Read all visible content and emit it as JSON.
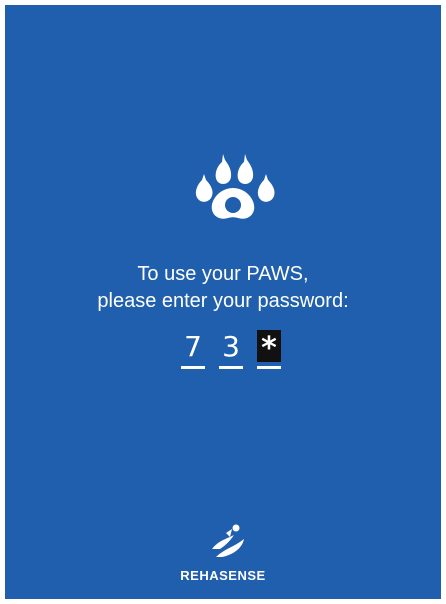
{
  "screen": {
    "background_color": "#1f5fae",
    "icon": "paw-icon",
    "prompt_line1": "To use your PAWS,",
    "prompt_line2": "please enter your password:",
    "pin": {
      "entered_digits": [
        "7",
        "3"
      ],
      "masked_char": "*"
    },
    "footer": {
      "logo_icon": "rehasense-logo",
      "brand": "REHASENSE"
    }
  }
}
